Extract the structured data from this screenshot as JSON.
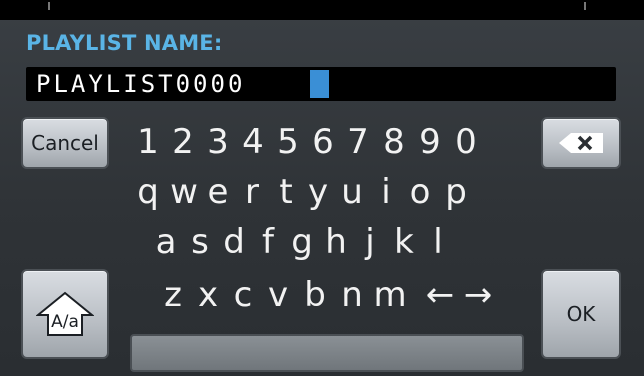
{
  "title": "PLAYLIST NAME:",
  "field": {
    "value": "PLAYLIST0000"
  },
  "buttons": {
    "cancel": "Cancel",
    "shift": "A/a",
    "ok": "OK"
  },
  "keys": {
    "row1": [
      "1",
      "2",
      "3",
      "4",
      "5",
      "6",
      "7",
      "8",
      "9",
      "0"
    ],
    "row2": [
      "q",
      "w",
      "e",
      "r",
      "t",
      "y",
      "u",
      "i",
      "o",
      "p"
    ],
    "row3": [
      "a",
      "s",
      "d",
      "f",
      "g",
      "h",
      "j",
      "k",
      "l"
    ],
    "row4": [
      "z",
      "x",
      "c",
      "v",
      "b",
      "n",
      "m",
      "←",
      "→"
    ]
  },
  "colors": {
    "accent": "#5ab4e6",
    "cursor": "#3a8fd6",
    "background": "#33383c"
  },
  "icons": {
    "backspace": "backspace-icon",
    "shift": "shift-icon"
  }
}
